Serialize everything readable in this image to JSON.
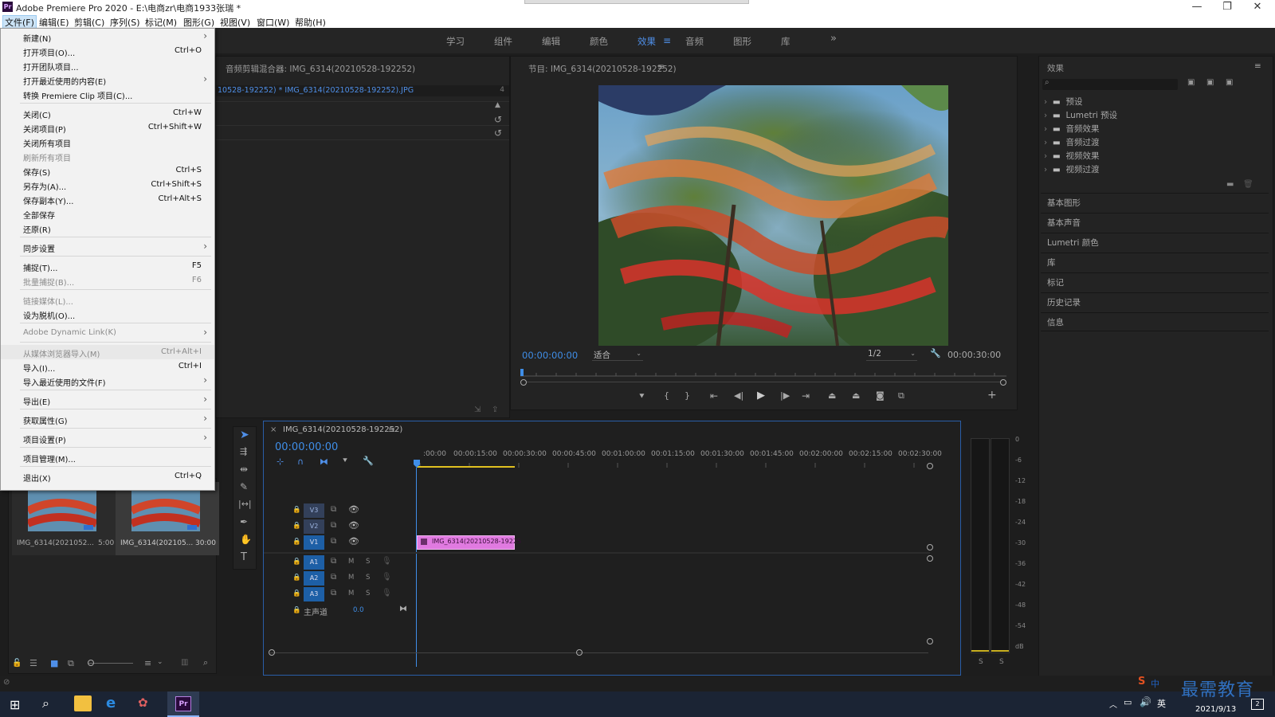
{
  "window": {
    "title": "Adobe Premiere Pro 2020 - E:\\电商zr\\电商1933张瑞 *",
    "app_icon": "Pr",
    "minimize": "—",
    "restore": "❐",
    "close": "✕"
  },
  "menubar": {
    "items": [
      "文件(F)",
      "编辑(E)",
      "剪辑(C)",
      "序列(S)",
      "标记(M)",
      "图形(G)",
      "视图(V)",
      "窗口(W)",
      "帮助(H)"
    ]
  },
  "workspaces": {
    "tabs": [
      "学习",
      "组件",
      "编辑",
      "颜色",
      "效果",
      "音频",
      "图形",
      "库"
    ],
    "active": "效果",
    "more": "»"
  },
  "file_menu": {
    "items": [
      {
        "label": "新建(N)",
        "shortcut": "",
        "arrow": "›"
      },
      {
        "label": "打开项目(O)...",
        "shortcut": "Ctrl+O",
        "arrow": ""
      },
      {
        "label": "打开团队项目...",
        "shortcut": "",
        "arrow": ""
      },
      {
        "label": "打开最近使用的内容(E)",
        "shortcut": "",
        "arrow": "›"
      },
      {
        "label": "转换 Premiere Clip 项目(C)...",
        "shortcut": "",
        "arrow": ""
      },
      {
        "label": "关闭(C)",
        "shortcut": "Ctrl+W",
        "arrow": ""
      },
      {
        "label": "关闭项目(P)",
        "shortcut": "Ctrl+Shift+W",
        "arrow": ""
      },
      {
        "label": "关闭所有项目",
        "shortcut": "",
        "arrow": ""
      },
      {
        "label": "刷新所有项目",
        "shortcut": "",
        "arrow": ""
      },
      {
        "label": "保存(S)",
        "shortcut": "Ctrl+S",
        "arrow": ""
      },
      {
        "label": "另存为(A)...",
        "shortcut": "Ctrl+Shift+S",
        "arrow": ""
      },
      {
        "label": "保存副本(Y)...",
        "shortcut": "Ctrl+Alt+S",
        "arrow": ""
      },
      {
        "label": "全部保存",
        "shortcut": "",
        "arrow": ""
      },
      {
        "label": "还原(R)",
        "shortcut": "",
        "arrow": ""
      },
      {
        "label": "同步设置",
        "shortcut": "",
        "arrow": "›"
      },
      {
        "label": "捕捉(T)...",
        "shortcut": "F5",
        "arrow": ""
      },
      {
        "label": "批量捕捉(B)...",
        "shortcut": "F6",
        "arrow": ""
      },
      {
        "label": "链接媒体(L)...",
        "shortcut": "",
        "arrow": ""
      },
      {
        "label": "设为脱机(O)...",
        "shortcut": "",
        "arrow": ""
      },
      {
        "label": "Adobe Dynamic Link(K)",
        "shortcut": "",
        "arrow": "›"
      },
      {
        "label": "从媒体浏览器导入(M)",
        "shortcut": "Ctrl+Alt+I",
        "arrow": ""
      },
      {
        "label": "导入(I)...",
        "shortcut": "Ctrl+I",
        "arrow": ""
      },
      {
        "label": "导入最近使用的文件(F)",
        "shortcut": "",
        "arrow": "›"
      },
      {
        "label": "导出(E)",
        "shortcut": "",
        "arrow": "›"
      },
      {
        "label": "获取属性(G)",
        "shortcut": "",
        "arrow": "›"
      },
      {
        "label": "项目设置(P)",
        "shortcut": "",
        "arrow": "›"
      },
      {
        "label": "项目管理(M)...",
        "shortcut": "",
        "arrow": ""
      },
      {
        "label": "退出(X)",
        "shortcut": "Ctrl+Q",
        "arrow": ""
      }
    ]
  },
  "source_panel": {
    "title": "音频剪辑混合器: IMG_6314(20210528-192252)",
    "tab": "10528-192252) * IMG_6314(20210528-192252).JPG",
    "tab_count": "4"
  },
  "program_monitor": {
    "title": "节目: IMG_6314(20210528-192252)",
    "timecode": "00:00:00:00",
    "fit": "适合",
    "resolution": "1/2",
    "duration": "00:00:30:00"
  },
  "project_panel": {
    "clips": [
      {
        "name": "IMG_6314(2021052...",
        "duration": "5:00"
      },
      {
        "name": "IMG_6314(202105...",
        "duration": "30:00"
      }
    ]
  },
  "timeline": {
    "sequence_name": "IMG_6314(20210528-192252)",
    "close": "×",
    "timecode": "00:00:00:00",
    "ruler": [
      ":00:00",
      "00:00:15:00",
      "00:00:30:00",
      "00:00:45:00",
      "00:01:00:00",
      "00:01:15:00",
      "00:01:30:00",
      "00:01:45:00",
      "00:02:00:00",
      "00:02:15:00",
      "00:02:30:00"
    ],
    "video_tracks": [
      "V3",
      "V2",
      "V1"
    ],
    "audio_tracks": [
      "A1",
      "A2",
      "A3"
    ],
    "mute": "M",
    "solo": "S",
    "master_label": "主声道",
    "master_value": "0.0",
    "clip_name": "IMG_6314(20210528-19225"
  },
  "audio_meter": {
    "scale": [
      "0",
      "-6",
      "-12",
      "-18",
      "-24",
      "-30",
      "-36",
      "-42",
      "-48",
      "-54",
      "dB"
    ],
    "solo_left": "S",
    "solo_right": "S"
  },
  "effects_panel": {
    "title": "效果",
    "tree": [
      "预设",
      "Lumetri 预设",
      "音频效果",
      "音频过渡",
      "视频效果",
      "视频过渡"
    ],
    "sections": [
      "基本图形",
      "基本声音",
      "Lumetri 颜色",
      "库",
      "标记",
      "历史记录",
      "信息"
    ]
  },
  "taskbar": {
    "date": "2021/9/13",
    "ime": "中",
    "watermark": "最需教育",
    "notification_count": "2"
  }
}
